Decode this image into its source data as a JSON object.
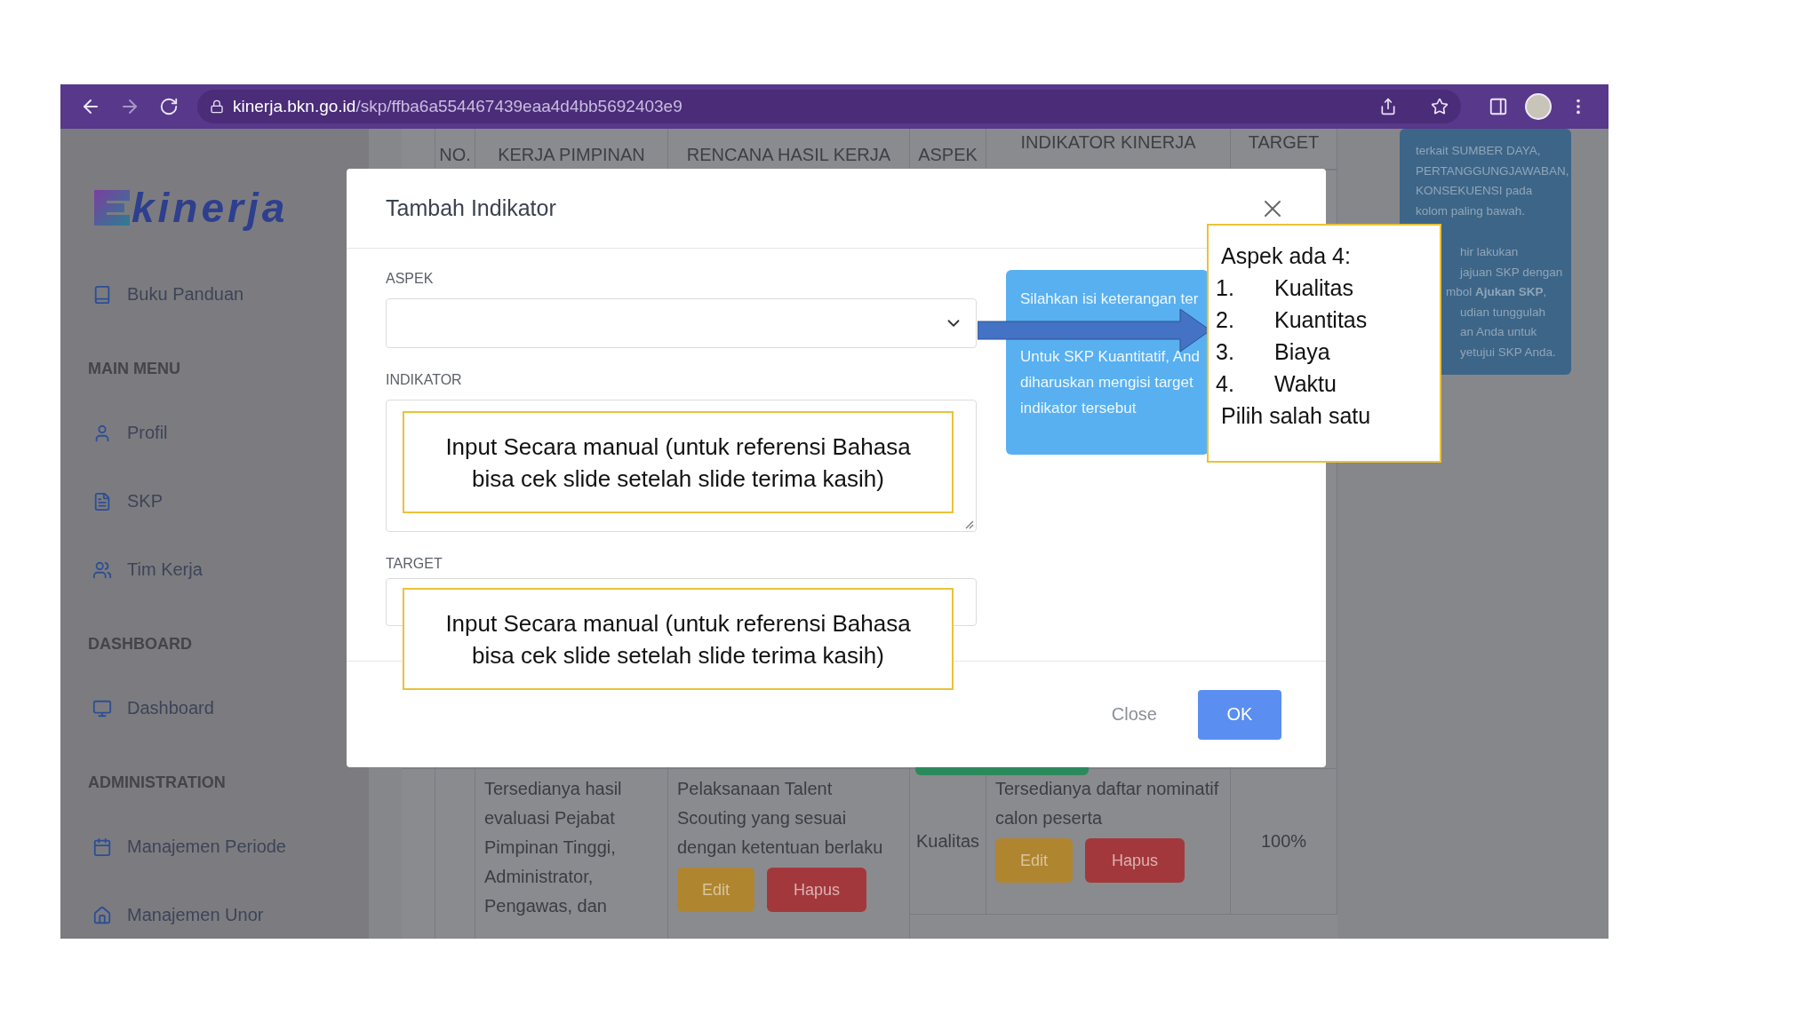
{
  "browser": {
    "url_host": "kinerja.bkn.go.id",
    "url_path": "/skp/ffba6a554467439eaa4d4bb5692403e9"
  },
  "sidebar": {
    "logo_text": "kinerja",
    "items": [
      {
        "kind": "link",
        "label": "Buku Panduan"
      },
      {
        "kind": "section",
        "label": "MAIN MENU"
      },
      {
        "kind": "link",
        "label": "Profil"
      },
      {
        "kind": "link",
        "label": "SKP"
      },
      {
        "kind": "link",
        "label": "Tim Kerja"
      },
      {
        "kind": "section",
        "label": "DASHBOARD"
      },
      {
        "kind": "link",
        "label": "Dashboard"
      },
      {
        "kind": "section",
        "label": "ADMINISTRATION"
      },
      {
        "kind": "link",
        "label": "Manajemen Periode"
      },
      {
        "kind": "link",
        "label": "Manajemen Unor"
      }
    ]
  },
  "table": {
    "columns": [
      "NO.",
      "KERJA PIMPINAN",
      "RENCANA HASIL KERJA",
      "ASPEK",
      "INDIKATOR KINERJA",
      "TARGET"
    ],
    "rows": [
      {
        "rencana_pimpinan": "Tersedianya hasil evaluasi Pejabat Pimpinan Tinggi, Administrator, Pengawas, dan",
        "rencana": "Pelaksanaan Talent Scouting yang sesuai dengan ketentuan berlaku",
        "aspek": "Kualitas",
        "indikator": "Tersedianya daftar nominatif calon peserta",
        "target": "100%",
        "rencana_buttons": [
          "Edit",
          "Hapus"
        ],
        "indikator_buttons": [
          "Edit",
          "Hapus"
        ]
      }
    ]
  },
  "side_note": {
    "lines": [
      "terkait SUMBER DAYA,",
      "PERTANGGUNGJAWABAN,",
      "KONSEKUENSI pada",
      "kolom paling bawah."
    ],
    "partial_lines": [
      "hir lakukan",
      "jajuan SKP dengan",
      "mbol **Ajukan SKP**,",
      "udian tunggulah",
      "an Anda untuk",
      "yetujui SKP Anda."
    ]
  },
  "dialog": {
    "title": "Tambah Indikator",
    "fields": [
      {
        "kind": "select",
        "label": "ASPEK"
      },
      {
        "kind": "textarea",
        "label": "INDIKATOR"
      },
      {
        "kind": "input",
        "label": "TARGET"
      }
    ],
    "info": [
      [
        "Silahkan isi keterangan ter"
      ],
      [
        "Untuk SKP Kuantitatif, And",
        "diharuskan mengisi target",
        "indikator tersebut"
      ]
    ],
    "buttons": [
      {
        "kind": "link",
        "label": "Close"
      },
      {
        "kind": "primary",
        "label": "OK"
      }
    ]
  },
  "annotations": {
    "notes": [
      "Input Secara manual (untuk referensi Bahasa bisa cek slide setelah slide terima kasih)",
      "Input Secara manual (untuk referensi Bahasa bisa cek slide setelah slide terima kasih)"
    ],
    "aspect_box": {
      "title": "Aspek ada 4:",
      "items": [
        {
          "number": "1.",
          "label": "Kualitas"
        },
        {
          "number": "2.",
          "label": "Kuantitas"
        },
        {
          "number": "3.",
          "label": "Biaya"
        },
        {
          "number": "4.",
          "label": "Waktu"
        }
      ],
      "footer": "Pilih salah satu"
    }
  }
}
